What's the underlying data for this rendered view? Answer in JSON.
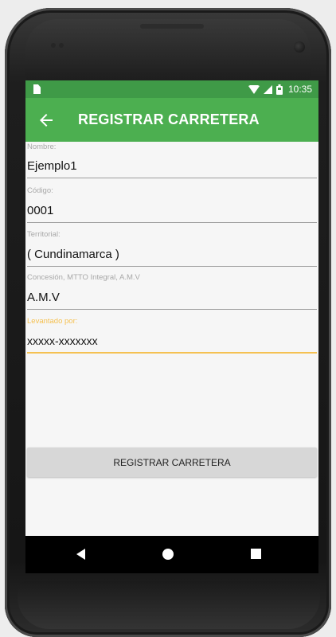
{
  "status_bar": {
    "time": "10:35",
    "icons": [
      "sim-card-icon",
      "wifi-icon",
      "signal-icon",
      "battery-icon"
    ]
  },
  "app_bar": {
    "back_icon": "arrow-left-icon",
    "title": "REGISTRAR CARRETERA"
  },
  "form": {
    "fields": [
      {
        "label": "Nombre:",
        "value": "Ejemplo1",
        "focused": false
      },
      {
        "label": "Código:",
        "value": "0001",
        "focused": false
      },
      {
        "label": "Territorial:",
        "value": "( Cundinamarca )",
        "focused": false
      },
      {
        "label": "Concesión, MTTO Integral, A.M.V",
        "value": "A.M.V",
        "focused": false
      },
      {
        "label": "Levantado por:",
        "value": "xxxxx-xxxxxxx",
        "focused": true
      }
    ],
    "submit_label": "REGISTRAR CARRETERA"
  },
  "nav_bar": {
    "icons": [
      "back-triangle-icon",
      "home-circle-icon",
      "recents-square-icon"
    ]
  },
  "colors": {
    "status_bar": "#3f9a47",
    "app_bar": "#4caf50",
    "focus_accent": "#f5c152",
    "button": "#d7d7d7"
  }
}
